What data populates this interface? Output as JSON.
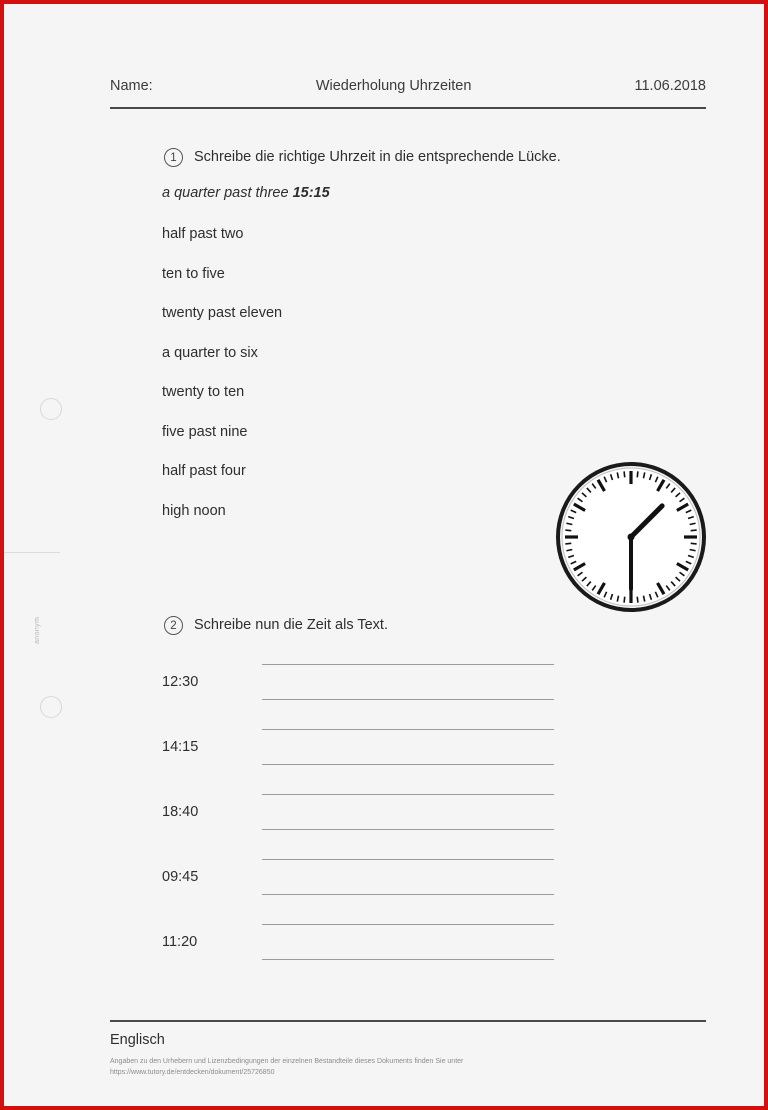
{
  "page": {
    "border_color": "#d40f0f",
    "background_color": "#f5f5f5",
    "margin_note": "anonym"
  },
  "header": {
    "name_label": "Name:",
    "title": "Wiederholung Uhrzeiten",
    "date": "11.06.2018"
  },
  "task1": {
    "number": "1",
    "instruction": "Schreibe die richtige Uhrzeit in die entsprechende Lücke.",
    "example": {
      "phrase": "a quarter past three ",
      "time": "15:15"
    },
    "phrases": [
      "half past two",
      "ten to five",
      "twenty past eleven",
      "a quarter to six",
      "twenty to ten",
      "five past nine",
      "half past four",
      "high noon"
    ]
  },
  "clock": {
    "name": "analog-clock",
    "displayed_time": "1:30",
    "hour_hand_angle_deg": 45,
    "minute_hand_angle_deg": 180,
    "has_numerals": false,
    "tick_count": 60
  },
  "task2": {
    "number": "2",
    "instruction": "Schreibe nun die Zeit als Text.",
    "times": [
      "12:30",
      "14:15",
      "18:40",
      "09:45",
      "11:20"
    ]
  },
  "footer": {
    "subject": "Englisch",
    "legal_line1": "Angaben zu den Urhebern und Lizenzbedingungen der einzelnen Bestandteile dieses Dokuments finden Sie unter",
    "legal_line2": "https://www.tutory.de/entdecken/dokument/25726850"
  }
}
